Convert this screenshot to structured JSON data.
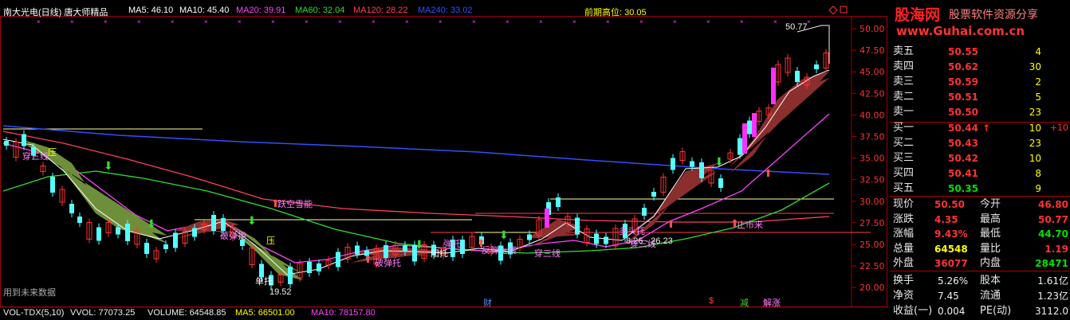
{
  "header": {
    "title": "南大光电(日线) 唐大师精品",
    "ma": [
      {
        "label": "MA5: 46.10",
        "color": "#ffffff"
      },
      {
        "label": "MA10: 45.40",
        "color": "#ffffff"
      },
      {
        "label": "MA20: 39.91",
        "color": "#ff44ff"
      },
      {
        "label": "MA60: 32.04",
        "color": "#33dd33"
      },
      {
        "label": "MA120: 28.22",
        "color": "#ff4060"
      },
      {
        "label": "MA240: 33.02",
        "color": "#3050ff"
      }
    ]
  },
  "chart_data": {
    "type": "candlestick",
    "y_ticks": [
      "50.00",
      "47.50",
      "45.00",
      "42.50",
      "40.00",
      "37.50",
      "35.00",
      "32.50",
      "30.00",
      "27.50",
      "25.00",
      "22.50",
      "20.00"
    ],
    "annotations": {
      "prev_high": "前期高位: 30.05",
      "peak_price": "50.77",
      "low_price": "19.52",
      "range_label": "8.26 - 26.23",
      "future_data_notice": "用到未来数据",
      "signals": [
        "穿三线",
        "压",
        "破弹指",
        "压",
        "单托",
        "破弹托",
        "阳托",
        "弹托",
        "反弹上线",
        "穿三线",
        "多头托",
        "跃空雪能",
        "止市来",
        "穿三线"
      ],
      "events": [
        "财",
        "$",
        "减",
        "解涨"
      ]
    }
  },
  "volume_bar": {
    "indicator": "VOL-TDX(5,10)",
    "vvol": "VVOL: 77073.25",
    "volume": "VOLUME: 64548.85",
    "ma5": "MA5: 66501.00",
    "ma10": "MA10: 78157.80"
  },
  "logo": {
    "cn": "股海网",
    "sub": "股票软件资源分享",
    "url": "www.Guhai.com.cn"
  },
  "order_book": {
    "asks": [
      {
        "label": "卖五",
        "price": "50.55",
        "vol": "4"
      },
      {
        "label": "卖四",
        "price": "50.62",
        "vol": "30"
      },
      {
        "label": "卖三",
        "price": "50.59",
        "vol": "2"
      },
      {
        "label": "卖二",
        "price": "50.51",
        "vol": "5"
      },
      {
        "label": "卖一",
        "price": "50.50",
        "vol": "23"
      }
    ],
    "bids": [
      {
        "label": "买一",
        "price": "50.44",
        "vol": "10",
        "arrow": "↑",
        "delta": "+10"
      },
      {
        "label": "买二",
        "price": "50.43",
        "vol": "23"
      },
      {
        "label": "买三",
        "price": "50.42",
        "vol": "10"
      },
      {
        "label": "买四",
        "price": "50.41",
        "vol": "8"
      },
      {
        "label": "买五",
        "price": "50.35",
        "vol": "9"
      }
    ]
  },
  "quote": {
    "rows": [
      {
        "l1": "现价",
        "v1": "50.50",
        "c1": "red",
        "l2": "今开",
        "v2": "46.80",
        "c2": "red"
      },
      {
        "l1": "涨跌",
        "v1": "4.35",
        "c1": "red",
        "l2": "最高",
        "v2": "50.77",
        "c2": "red"
      },
      {
        "l1": "涨幅",
        "v1": "9.43%",
        "c1": "red",
        "l2": "最低",
        "v2": "44.70",
        "c2": "grn"
      },
      {
        "l1": "总量",
        "v1": "64548",
        "c1": "yel",
        "l2": "量比",
        "v2": "1.19",
        "c2": "red"
      },
      {
        "l1": "外盘",
        "v1": "36077",
        "c1": "red",
        "l2": "内盘",
        "v2": "28471",
        "c2": "grn"
      }
    ],
    "rows2": [
      {
        "l1": "换手",
        "v1": "5.26%",
        "c1": "wht",
        "l2": "股本",
        "v2": "1.61亿",
        "c2": "wht"
      },
      {
        "l1": "净资",
        "v1": "7.45",
        "c1": "wht",
        "l2": "流通",
        "v2": "1.23亿",
        "c2": "wht"
      },
      {
        "l1": "收益(一)",
        "v1": "0.004",
        "c1": "wht",
        "l2": "PE(动)",
        "v2": "3112.0",
        "c2": "wht"
      }
    ]
  },
  "colors": {
    "up": "#ff3232",
    "down": "#54ffff",
    "ma5": "#ffffff",
    "ma20": "#ff44ff",
    "ma60": "#33dd33",
    "ma120": "#ff4060",
    "ma240": "#3050ff"
  }
}
